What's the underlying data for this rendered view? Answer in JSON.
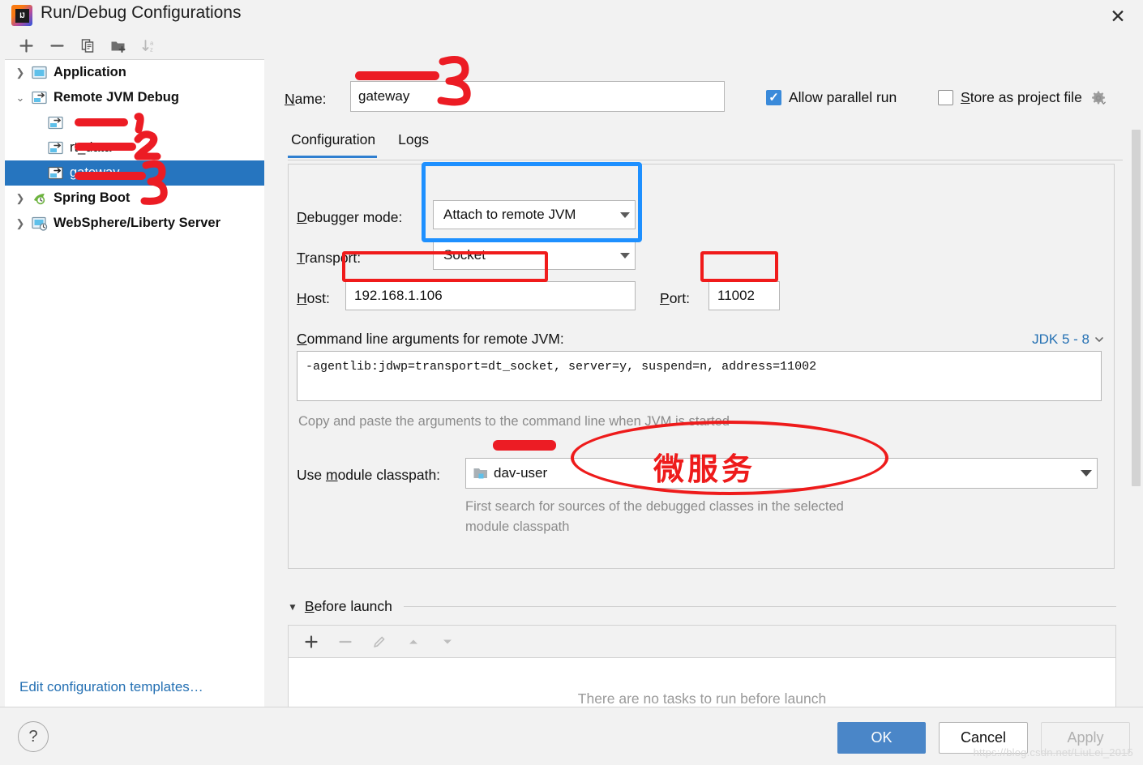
{
  "window": {
    "title": "Run/Debug Configurations",
    "logo_text": "IJ",
    "close_icon": "close-icon"
  },
  "sidebar": {
    "toolbar": [
      {
        "name": "add-configuration-button",
        "icon": "plus-icon",
        "glyph": "+",
        "disabled": false
      },
      {
        "name": "remove-configuration-button",
        "icon": "minus-icon",
        "glyph": "−",
        "disabled": false
      },
      {
        "name": "copy-configuration-button",
        "icon": "copy-icon",
        "glyph": "⧉",
        "disabled": false
      },
      {
        "name": "new-folder-button",
        "icon": "folder-plus-icon",
        "glyph": "🗀",
        "disabled": false
      },
      {
        "name": "sort-configurations-button",
        "icon": "sort-az-icon",
        "glyph": "↓az",
        "disabled": true
      }
    ],
    "tree": [
      {
        "label": "Application",
        "level": 0,
        "expanded": false,
        "twisty": "❯",
        "icon": "application-icon",
        "selected": false
      },
      {
        "label": "Remote JVM Debug",
        "level": 0,
        "expanded": true,
        "twisty": "⌄",
        "icon": "remote-jvm-debug-icon",
        "selected": false
      },
      {
        "label": "",
        "level": 1,
        "twisty": "",
        "icon": "remote-jvm-debug-icon",
        "selected": false,
        "redacted": true
      },
      {
        "label": "rt_data",
        "level": 1,
        "twisty": "",
        "icon": "remote-jvm-debug-icon",
        "selected": false,
        "redacted": true
      },
      {
        "label": "gateway",
        "level": 1,
        "twisty": "",
        "icon": "remote-jvm-debug-icon",
        "selected": true,
        "redacted": true
      },
      {
        "label": "Spring Boot",
        "level": 0,
        "expanded": false,
        "twisty": "❯",
        "icon": "spring-boot-icon",
        "selected": false
      },
      {
        "label": "WebSphere/Liberty Server",
        "level": 0,
        "expanded": false,
        "twisty": "❯",
        "icon": "websphere-icon",
        "selected": false
      }
    ],
    "edit_templates_link": "Edit configuration templates…"
  },
  "form": {
    "name_label": "Name:",
    "name_label_mnemonic": "N",
    "name_value": "gateway",
    "allow_parallel_run": {
      "label": "Allow parallel run",
      "checked": true
    },
    "store_as_project_file": {
      "label": "Store as project file",
      "checked": false,
      "gear_icon": "gear-icon"
    },
    "tabs": [
      {
        "label": "Configuration",
        "active": true
      },
      {
        "label": "Logs",
        "active": false
      }
    ],
    "debugger_mode": {
      "label": "Debugger mode:",
      "mnemonic": "D",
      "value": "Attach to remote JVM"
    },
    "transport": {
      "label": "Transport:",
      "mnemonic": "T",
      "value": "Socket"
    },
    "host": {
      "label": "Host:",
      "mnemonic": "H",
      "value": "192.168.1.106"
    },
    "port": {
      "label": "Port:",
      "mnemonic": "P",
      "value": "11002"
    },
    "command_line": {
      "label": "Command line arguments for remote JVM:",
      "mnemonic": "C",
      "value": "-agentlib:jdwp=transport=dt_socket, server=y, suspend=n, address=11002",
      "jdk_selector": "JDK 5 - 8",
      "hint": "Copy and paste the arguments to the command line when JVM is started"
    },
    "module_classpath": {
      "label": "Use module classpath:",
      "mnemonic": "m",
      "value": "dav-user",
      "icon": "module-icon",
      "hint_line1": "First search for sources of the debugged classes in the selected",
      "hint_line2": "module classpath"
    },
    "before_launch": {
      "title": "Before launch",
      "mnemonic": "B",
      "expanded": true,
      "toolbar": [
        {
          "name": "add-task-button",
          "icon": "plus-icon",
          "glyph": "+",
          "disabled": false
        },
        {
          "name": "remove-task-button",
          "icon": "minus-icon",
          "glyph": "−",
          "disabled": true
        },
        {
          "name": "edit-task-button",
          "icon": "pencil-icon",
          "glyph": "✎",
          "disabled": true
        },
        {
          "name": "move-task-up-button",
          "icon": "arrow-up-icon",
          "glyph": "▲",
          "disabled": true
        },
        {
          "name": "move-task-down-button",
          "icon": "arrow-down-icon",
          "glyph": "▼",
          "disabled": true
        }
      ],
      "empty_text": "There are no tasks to run before launch"
    }
  },
  "footer": {
    "help_label": "?",
    "ok_label": "OK",
    "cancel_label": "Cancel",
    "apply_label": "Apply",
    "apply_disabled": true
  },
  "annotations": {
    "marker_red": "#ec1c24",
    "marker_blue": "#1e90ff",
    "numbers": [
      "1",
      "2",
      "3",
      "3"
    ],
    "chinese_note": "微服务"
  },
  "watermark": "https://blog.csdn.net/LiuLei_2015"
}
